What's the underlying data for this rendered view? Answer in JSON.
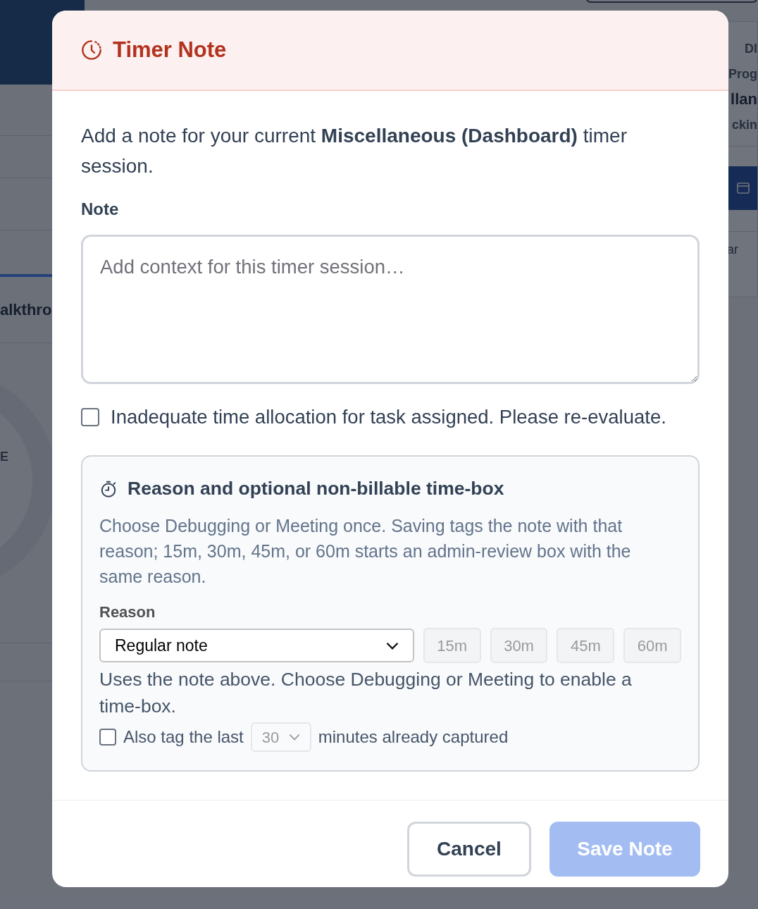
{
  "backdrop": {
    "left_texts": [
      {
        "kind": "heading",
        "text": "alkthro"
      },
      {
        "kind": "label",
        "text": "E"
      }
    ],
    "right_texts": [
      {
        "kind": "label",
        "text": "Dl"
      },
      {
        "kind": "label",
        "text": "Prog"
      },
      {
        "kind": "title",
        "text": "llan"
      },
      {
        "kind": "label",
        "text": "ckin"
      },
      {
        "kind": "tab",
        "text": "ar"
      }
    ]
  },
  "dialog": {
    "title": "Timer Note",
    "intro": "Add a note for your current **Miscellaneous (Dashboard)** timer session.",
    "note_label": "Note",
    "note_field": {
      "placeholder": "Add context for this timer session…"
    },
    "allocation_checkbox": {
      "label": "Inadequate time allocation for task assigned. Please re-evaluate.",
      "checked": false
    },
    "reason_panel": {
      "title": "Reason and optional non-billable time-box",
      "description": "Choose Debugging or Meeting once. Saving tags the note with that reason; 15m, 30m, 45m, or 60m starts an admin-review box with the same reason.",
      "reason_label": "Reason",
      "reason_select": {
        "value": "Regular note"
      },
      "timebox_buttons": [
        {
          "label": "15m",
          "disabled": true
        },
        {
          "label": "30m",
          "disabled": true
        },
        {
          "label": "45m",
          "disabled": true
        },
        {
          "label": "60m",
          "disabled": true
        }
      ],
      "hint": "Uses the note above. Choose Debugging or Meeting to enable a time-box.",
      "also_tag": {
        "checked": false,
        "prefix": "Also tag the last",
        "minutes": {
          "value": "30",
          "disabled": true
        },
        "suffix": "minutes already captured"
      }
    },
    "buttons": {
      "cancel": "Cancel",
      "save": {
        "label": "Save Note",
        "disabled": true
      }
    }
  }
}
